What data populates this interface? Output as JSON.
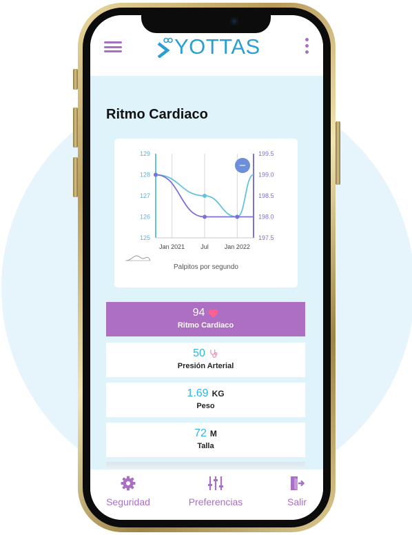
{
  "header": {
    "logo_text": "YOTTAS",
    "menu_icon": "hamburger-menu-icon",
    "more_icon": "vertical-dots-icon"
  },
  "page": {
    "title": "Ritmo Cardiaco"
  },
  "colors": {
    "brand_purple": "#ac6fc2",
    "brand_blue": "#2a9fd6",
    "accent_cyan": "#2eb3e6",
    "heart_pink": "#ff5f8f"
  },
  "chart_data": {
    "type": "line",
    "x": [
      "Oct 2020",
      "Jan 2021",
      "Jul 2021",
      "Jan 2022",
      "Apr 2022"
    ],
    "x_tick_labels": [
      "Jan 2021",
      "Jul",
      "Jan 2022"
    ],
    "y_left_ticks": [
      "125",
      "126",
      "127",
      "128",
      "129"
    ],
    "y_right_ticks": [
      "197.5",
      "198.0",
      "198.5",
      "199.0",
      "199.5"
    ],
    "ylim_left": [
      125,
      129
    ],
    "ylim_right": [
      197.5,
      199.5
    ],
    "series": [
      {
        "axis": "right",
        "color": "#5fc3df",
        "points": [
          [
            "Oct 2020",
            199.0
          ],
          [
            "Jul 2021",
            198.5
          ],
          [
            "Jan 2022",
            198.0
          ],
          [
            "Apr 2022",
            199.0
          ]
        ]
      },
      {
        "axis": "left",
        "color": "#7a72d8",
        "points": [
          [
            "Oct 2020",
            128.0
          ],
          [
            "Jul 2021",
            126.0
          ],
          [
            "Jan 2022",
            126.0
          ],
          [
            "Apr 2022",
            126.0
          ]
        ]
      }
    ],
    "zoom_button_label": "−",
    "caption": "Palpitos por segundo",
    "grid": "vertical"
  },
  "metrics": [
    {
      "value": "94",
      "unit": "",
      "icon": "heart-icon",
      "label": "Ritmo Cardiaco",
      "active": true
    },
    {
      "value": "50",
      "unit": "",
      "icon": "stethoscope-icon",
      "label": "Presión Arterial",
      "active": false
    },
    {
      "value": "1.69",
      "unit": "KG",
      "icon": "",
      "label": "Peso",
      "active": false
    },
    {
      "value": "72",
      "unit": "M",
      "icon": "",
      "label": "Talla",
      "active": false
    }
  ],
  "tabs": [
    {
      "label": "Seguridad",
      "icon": "gear-icon"
    },
    {
      "label": "Preferencias",
      "icon": "sliders-icon"
    },
    {
      "label": "Salir",
      "icon": "exit-door-icon"
    }
  ]
}
